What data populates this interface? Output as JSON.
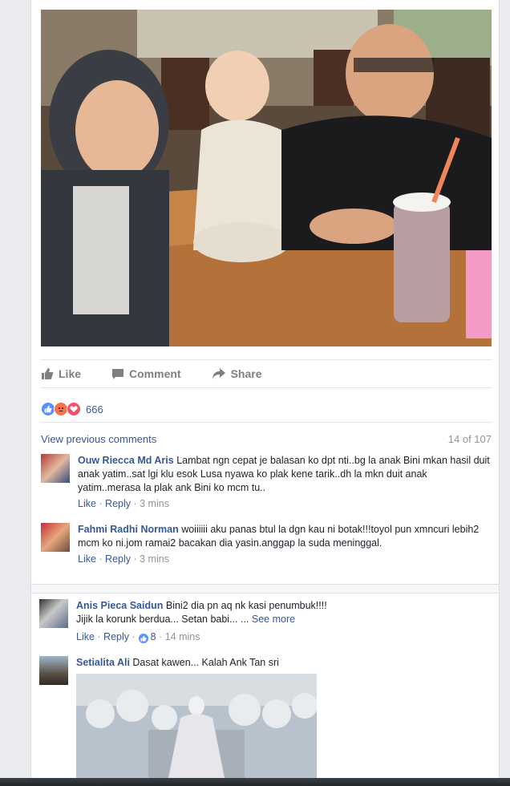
{
  "actions": {
    "like": "Like",
    "comment": "Comment",
    "share": "Share"
  },
  "reactions": {
    "count": "666",
    "colors": {
      "like": "#5890ff",
      "angry": "#f7714b",
      "love": "#f25268"
    }
  },
  "previous": {
    "link": "View previous comments",
    "count": "14 of 107"
  },
  "comments": [
    {
      "name": "Ouw Riecca Md Aris",
      "text": "Lambat ngn cepat je balasan ko dpt nti..bg la anak Bini mkan hasil duit anak yatim..sat lgi klu esok Lusa nyawa ko plak kene tarik..dh la mkn duit anak yatim..merasa la plak ank Bini ko mcm tu..",
      "like": "Like",
      "reply": "Reply",
      "time": "3 mins"
    },
    {
      "name": "Fahmi Radhi Norman",
      "text": "woiiiiii aku panas btul la dgn kau ni botak!!!toyol pun xmncuri lebih2 mcm ko ni.jom ramai2 bacakan dia yasin.anggap la suda meninggal.",
      "like": "Like",
      "reply": "Reply",
      "time": "3 mins"
    },
    {
      "name": "Anis Pieca Saidun",
      "text": "Bini2 dia pn aq nk kasi penumbuk!!!!",
      "text2": "Jijik la korunk berdua... Setan babi... ...",
      "see_more": "See more",
      "like": "Like",
      "reply": "Reply",
      "likes": "8",
      "time": "14 mins"
    },
    {
      "name": "Setialita Ali",
      "text": "Dasat kawen... Kalah Ank Tan sri"
    }
  ]
}
